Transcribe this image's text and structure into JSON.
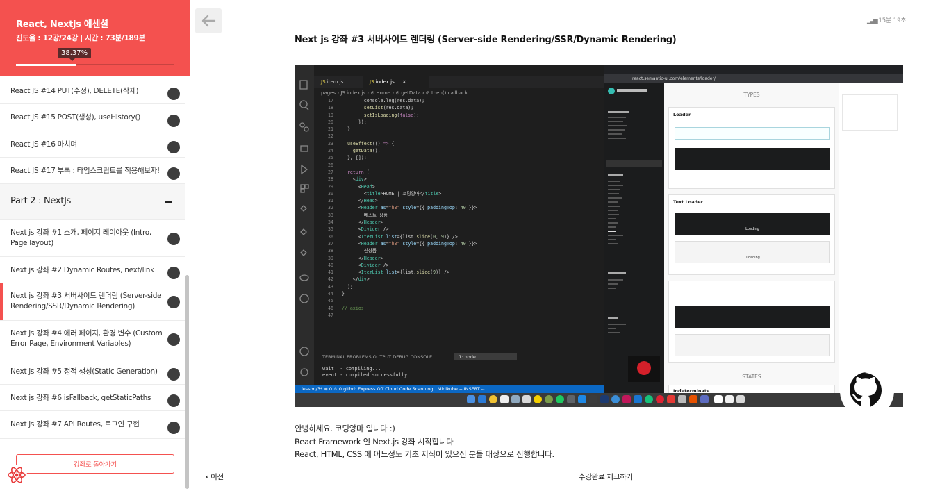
{
  "course": {
    "title": "React, Nextjs 에센셜",
    "stats": "진도율 : 12강/24강 | 시간 : 73분/189분",
    "progress_label": "38.37%",
    "progress_fraction": 0.3837
  },
  "lessons_part1": [
    {
      "title": "React JS #14 PUT(수정), DELETE(삭제)"
    },
    {
      "title": "React JS #15 POST(생성), useHistory()"
    },
    {
      "title": "React JS #16 마치며"
    },
    {
      "title": "React JS #17 부록 : 타입스크립트를 적용해보자!"
    }
  ],
  "part2": {
    "title": "Part 2 : NextJs",
    "lessons": [
      {
        "title": "Next js 강좌 #1 소개, 페이지 레이아웃 (Intro, Page layout)"
      },
      {
        "title": "Next js 강좌 #2 Dynamic Routes, next/link"
      },
      {
        "title": "Next js 강좌 #3 서버사이드 렌더링 (Server-side Rendering/SSR/Dynamic Rendering)"
      },
      {
        "title": "Next js 강좌 #4 에러 페이지, 환경 변수 (Custom Error Page, Environment Variables)"
      },
      {
        "title": "Next js 강좌 #5 정적 생성(Static Generation)"
      },
      {
        "title": "Next js 강좌 #6 isFallback, getStaticPaths"
      },
      {
        "title": "Next js 강좌 #7 API Routes, 로그인 구현"
      }
    ]
  },
  "sidebar_footer": {
    "back_button": "강좌로 돌아가기"
  },
  "main": {
    "time_left": "15분 19초",
    "heading": "Next js 강좌 #3 서버사이드 렌더링 (Server-side Rendering/SSR/Dynamic Rendering)",
    "description": [
      "안녕하세요. 코딩앙마 입니다 :)",
      "React Framework 인 Next.js 강좌 시작합니다",
      "React, HTML, CSS 에 어느정도 기초 지식이 있으신 분들 대상으로 진행합니다."
    ],
    "prev_label": "이전",
    "complete_label": "수강완료 체크하기"
  },
  "video": {
    "tab1": "item.js",
    "tab2": "index.js",
    "crumb": "pages › JS index.js › ⊘ Home › ⊘ getData › ⊘ then() callback",
    "terminal_tabs": "TERMINAL   PROBLEMS   OUTPUT   DEBUG CONSOLE",
    "terminal_node": "1: node",
    "terminal_out": "wait  - compiling...\nevent - compiled successfully",
    "status": "lesson/3*   ⊗ 0 ⚠ 0   githd: Express Off   Cloud Code   Scanning..   Minikube   -- INSERT --",
    "browser_url": "react.semantic-ui.com/elements/loader/",
    "types_heading": "TYPES",
    "states_heading": "STATES",
    "loader_label": "Loader",
    "text_loader_label": "Text Loader",
    "loading_text": "Loading",
    "indeterminate_label": "Indeterminate"
  },
  "colors": {
    "accent": "#f4514f",
    "progress_tip": "#5a2a2a"
  },
  "icons": {
    "back": "arrow-left-icon",
    "lesson_status": "circle-icon",
    "collapse": "minus-icon",
    "prev": "chevron-left-icon",
    "logo": "react-logo-icon"
  }
}
